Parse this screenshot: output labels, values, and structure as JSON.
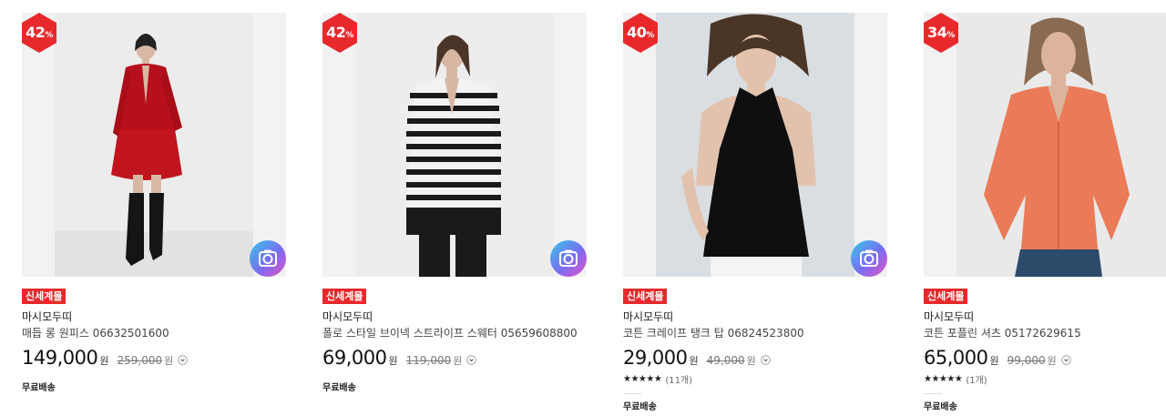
{
  "products": [
    {
      "discount": "42",
      "discount_unit": "%",
      "badge": "신세계몰",
      "brand": "마시모두띠",
      "name": "매듭 롱 원피스 06632501600",
      "price": "149,000",
      "price_unit": "원",
      "original_price": "259,000",
      "original_unit": "원",
      "shipping": "무료배송",
      "image_description_icon": "red-dress-photo",
      "has_camera": true
    },
    {
      "discount": "42",
      "discount_unit": "%",
      "badge": "신세계몰",
      "brand": "마시모두띠",
      "name": "폴로 스타일 브이넥 스트라이프 스웨터 05659608800",
      "price": "69,000",
      "price_unit": "원",
      "original_price": "119,000",
      "original_unit": "원",
      "shipping": "무료배송",
      "image_description_icon": "striped-sweater-photo",
      "has_camera": true
    },
    {
      "discount": "40",
      "discount_unit": "%",
      "badge": "신세계몰",
      "brand": "마시모두띠",
      "name": "코튼 크레이프 탱크 탑 06824523800",
      "price": "29,000",
      "price_unit": "원",
      "original_price": "49,000",
      "original_unit": "원",
      "stars": "★★★★★",
      "review_count": "(11개)",
      "shipping": "무료배송",
      "image_description_icon": "black-tank-top-photo",
      "has_camera": true
    },
    {
      "discount": "34",
      "discount_unit": "%",
      "badge": "신세계몰",
      "brand": "마시모두띠",
      "name": "코튼 포플린 셔츠 05172629615",
      "price": "65,000",
      "price_unit": "원",
      "original_price": "99,000",
      "original_unit": "원",
      "stars": "★★★★★",
      "review_count": "(1개)",
      "shipping": "무료배송",
      "image_description_icon": "orange-shirt-photo",
      "has_camera": false
    }
  ],
  "colors": {
    "discount_red": "#e8292c",
    "badge_red": "#e8292c",
    "camera_gradient": [
      "#36c7e6",
      "#7a6cf2",
      "#e551c3"
    ]
  }
}
